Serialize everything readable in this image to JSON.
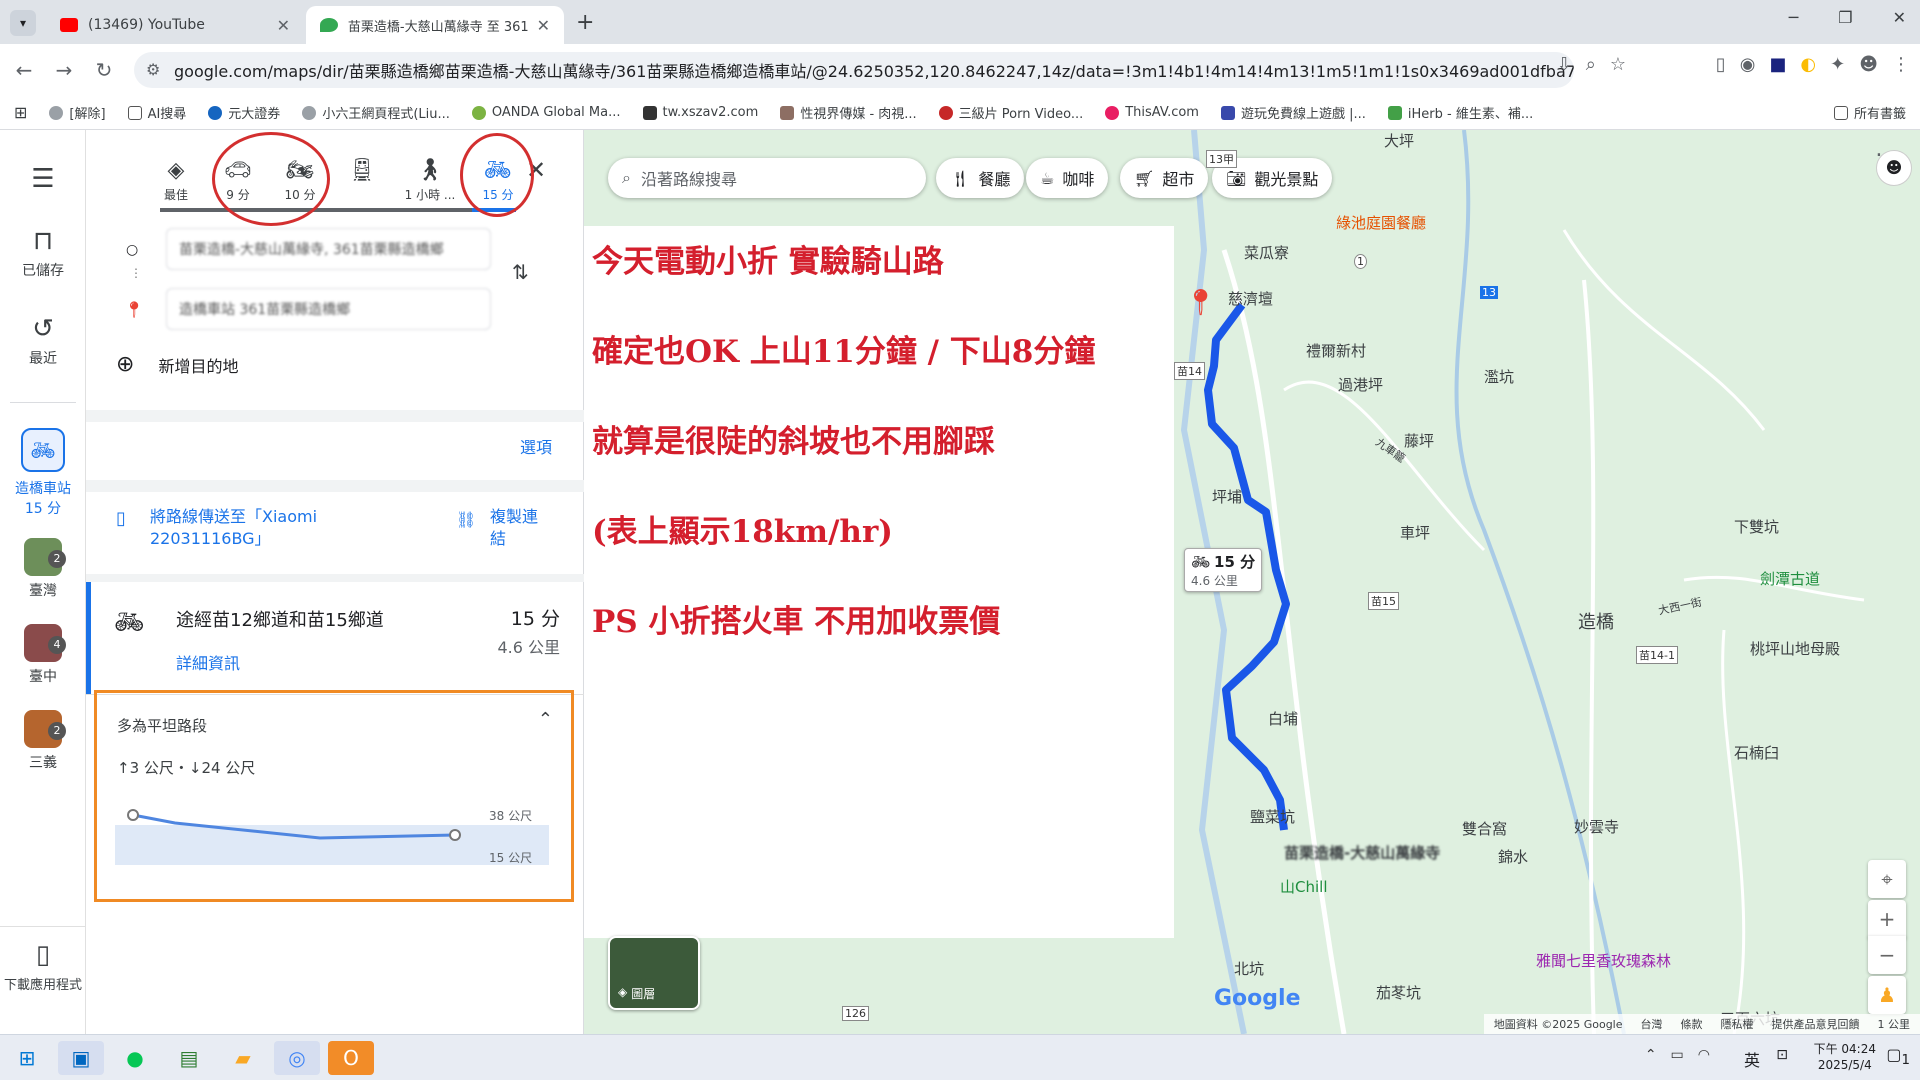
{
  "browser": {
    "tabs": [
      {
        "title": "(13469) YouTube"
      },
      {
        "title": "苗栗造橋-大慈山萬緣寺 至 361"
      }
    ],
    "new_tab": "+",
    "url": "google.com/maps/dir/苗栗縣造橋鄉苗栗造橋-大慈山萬緣寺/361苗栗縣造橋鄉造橋車站/@24.6250352,120.8462247,14z/data=!3m1!4b1!4m14!4m13!1m5!1m1!1s0x3469ad001dfba7d...",
    "bookmarks": [
      "[解除]",
      "AI搜尋",
      "元大證券",
      "小六王網頁程式(Liu...",
      "OANDA Global Ma...",
      "tw.xszav2.com",
      "性視界傳媒 - 肉視...",
      "三級片 Porn Video...",
      "ThisAV.com",
      "遊玩免費線上遊戲 |...",
      "iHerb - 維生素、補..."
    ],
    "all_bookmarks": "所有書籤"
  },
  "rail": {
    "saved": "已儲存",
    "recent": "最近",
    "active": {
      "line1": "造橋車站",
      "line2": "15 分"
    },
    "recents": [
      {
        "label": "臺灣",
        "badge": "2"
      },
      {
        "label": "臺中",
        "badge": "4"
      },
      {
        "label": "三義",
        "badge": "2"
      }
    ],
    "download": "下載應用程式"
  },
  "panel": {
    "modes": [
      {
        "icon": "best-route-icon",
        "label": "最佳"
      },
      {
        "icon": "car-icon",
        "label": "9 分"
      },
      {
        "icon": "motorcycle-icon",
        "label": "10 分"
      },
      {
        "icon": "transit-icon",
        "label": ""
      },
      {
        "icon": "walk-icon",
        "label": "1 小時 ..."
      },
      {
        "icon": "bicycle-icon",
        "label": "15 分"
      }
    ],
    "origin": "苗栗造橋-大慈山萬緣寺, 361苗栗縣造橋鄉",
    "destination": "造橋車站 361苗栗縣造橋鄉",
    "add_destination": "新增目的地",
    "options": "選項",
    "send_route": "將路線傳送至「Xiaomi 22031116BG」",
    "copy_link": "複製連結",
    "route": {
      "name": "途經苗12鄉道和苗15鄉道",
      "time": "15 分",
      "distance": "4.6 公里",
      "details": "詳細資訊"
    },
    "elevation": {
      "title": "多為平坦路段",
      "summary": "↑3 公尺・↓24 公尺",
      "max_label": "38 公尺",
      "min_label": "15 公尺"
    }
  },
  "map": {
    "search_placeholder": "沿著路線搜尋",
    "chips": [
      "餐廳",
      "咖啡",
      "超市",
      "觀光景點"
    ],
    "note_lines": [
      "今天電動小折  實驗騎山路",
      "確定也OK  上山11分鐘 / 下山8分鐘",
      "就算是很陡的斜坡也不用腳踩",
      "(表上顯示18km/hr)",
      "PS  小折搭火車  不用加收票價"
    ],
    "route_badge": {
      "time": "15 分",
      "distance": "4.6 公里"
    },
    "places": [
      "綠池庭園餐廳",
      "菜瓜寮",
      "慈濟壇",
      "禮爾新村",
      "過港坪",
      "濫坑",
      "藤坪",
      "九車籠",
      "坪埔",
      "車坪",
      "下雙坑",
      "造橋",
      "劍潭古道",
      "桃坪山地母殿",
      "白埔",
      "石楠臼",
      "鹽菜坑",
      "雙合窩",
      "錦水",
      "妙雲寺",
      "山Chill",
      "北坑",
      "茄苳坑",
      "雅聞七里香玫瑰森林",
      "三百六坑",
      "大坪",
      "苗栗造橋-大慈山萬緣寺"
    ],
    "shields": [
      "13甲",
      "1",
      "13",
      "苗15",
      "苗14",
      "苗14-1",
      "126",
      "大西一街"
    ],
    "layers": "圖層",
    "footer": [
      "地圖資料 ©2025 Google",
      "台灣",
      "條款",
      "隱私權",
      "提供產品意見回饋",
      "1 公里"
    ],
    "google": "Google"
  },
  "taskbar": {
    "time": "下午 04:24",
    "date": "2025/5/4",
    "ime": "英",
    "notifications": "1"
  },
  "colors": {
    "route_blue": "#1a57e8",
    "red_note": "#d41f2d",
    "circle_red": "#d32f2f",
    "orange_box": "#f08a24",
    "map_green": "#dff0e0"
  }
}
